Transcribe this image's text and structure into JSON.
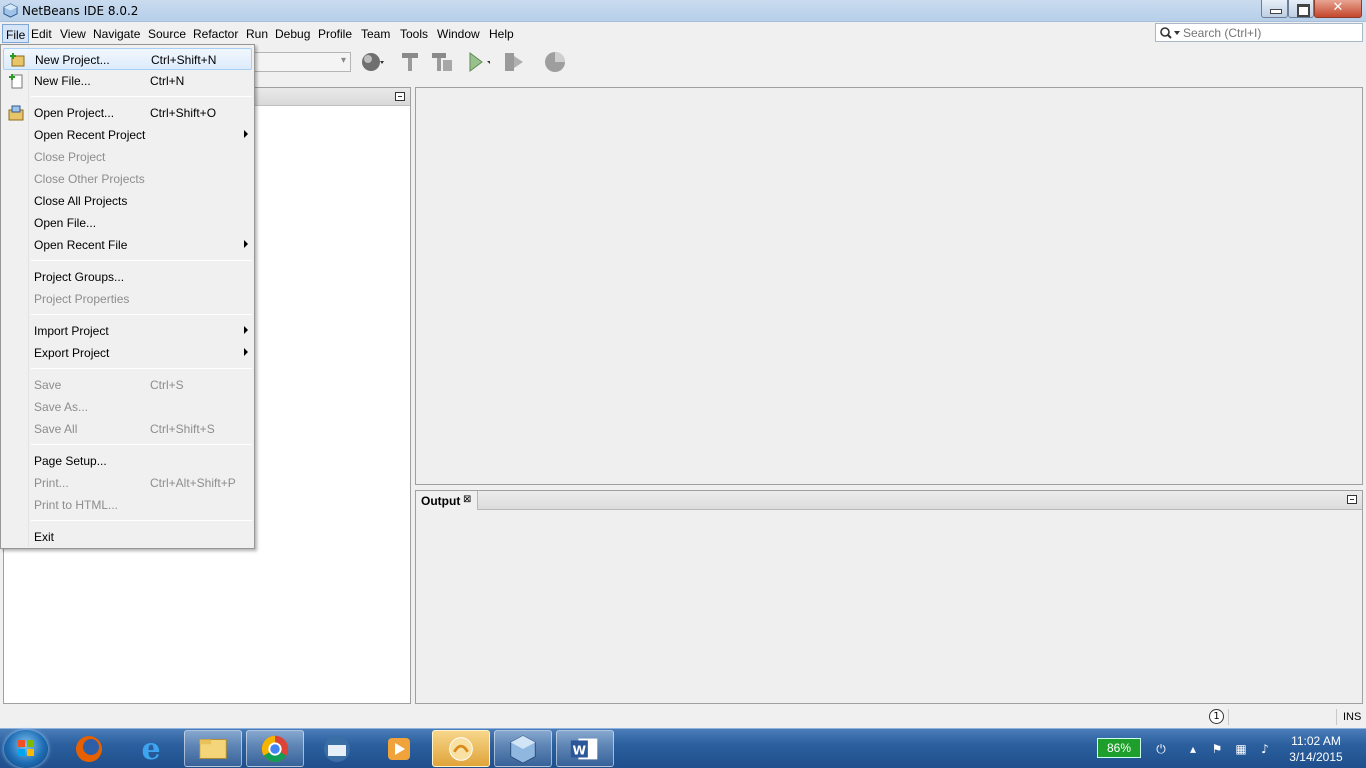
{
  "window": {
    "title": "NetBeans IDE 8.0.2",
    "close_glyph": "✕"
  },
  "menubar": {
    "items": [
      {
        "id": "file",
        "label": "File"
      },
      {
        "id": "edit",
        "label": "Edit"
      },
      {
        "id": "view",
        "label": "View"
      },
      {
        "id": "navigate",
        "label": "Navigate"
      },
      {
        "id": "source",
        "label": "Source"
      },
      {
        "id": "refactor",
        "label": "Refactor"
      },
      {
        "id": "run",
        "label": "Run"
      },
      {
        "id": "debug",
        "label": "Debug"
      },
      {
        "id": "profile",
        "label": "Profile"
      },
      {
        "id": "team",
        "label": "Team"
      },
      {
        "id": "tools",
        "label": "Tools"
      },
      {
        "id": "window",
        "label": "Window"
      },
      {
        "id": "help",
        "label": "Help"
      }
    ],
    "search_placeholder": "Search (Ctrl+I)"
  },
  "file_menu": {
    "items": [
      {
        "label": "New Project...",
        "shortcut": "Ctrl+Shift+N",
        "icon": "new-project-icon",
        "enabled": true,
        "hover": true
      },
      {
        "label": "New File...",
        "shortcut": "Ctrl+N",
        "icon": "new-file-icon",
        "enabled": true
      },
      {
        "label": "Open Project...",
        "shortcut": "Ctrl+Shift+O",
        "icon": "open-project-icon",
        "enabled": true
      },
      {
        "label": "Open Recent Project",
        "submenu": true,
        "enabled": true
      },
      {
        "label": "Close Project",
        "enabled": false
      },
      {
        "label": "Close Other Projects",
        "enabled": false
      },
      {
        "label": "Close All Projects",
        "enabled": true
      },
      {
        "label": "Open File...",
        "enabled": true
      },
      {
        "label": "Open Recent File",
        "submenu": true,
        "enabled": true
      },
      {
        "label": "Project Groups...",
        "enabled": true
      },
      {
        "label": "Project Properties",
        "enabled": false
      },
      {
        "label": "Import Project",
        "submenu": true,
        "enabled": true
      },
      {
        "label": "Export Project",
        "submenu": true,
        "enabled": true
      },
      {
        "label": "Save",
        "shortcut": "Ctrl+S",
        "enabled": false
      },
      {
        "label": "Save As...",
        "enabled": false
      },
      {
        "label": "Save All",
        "shortcut": "Ctrl+Shift+S",
        "enabled": false
      },
      {
        "label": "Page Setup...",
        "enabled": true
      },
      {
        "label": "Print...",
        "shortcut": "Ctrl+Alt+Shift+P",
        "enabled": false
      },
      {
        "label": "Print to HTML...",
        "enabled": false
      },
      {
        "label": "Exit",
        "enabled": true
      }
    ]
  },
  "output": {
    "tab_label": "Output",
    "close_glyph": "⊠"
  },
  "statusbar": {
    "notification_count": "1",
    "insert_mode": "INS"
  },
  "taskbar": {
    "apps": [
      "firefox-icon",
      "internet-explorer-icon",
      "file-explorer-icon",
      "chrome-icon",
      "thunderbird-icon",
      "media-player-icon",
      "netbeans-task-icon",
      "virtualbox-icon",
      "word-icon"
    ],
    "battery": "86%",
    "time": "11:02 AM",
    "date": "3/14/2015"
  },
  "colors": {
    "accent": "#3a74b6",
    "menu_hover": "#dcebfc",
    "disabled_text": "#8d8d8d"
  }
}
